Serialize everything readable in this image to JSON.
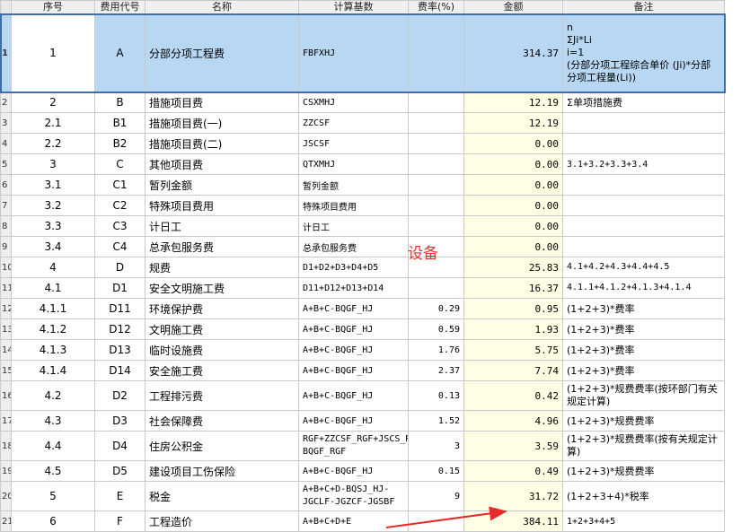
{
  "columns": {
    "seq": "序号",
    "code": "费用代号",
    "name": "名称",
    "base": "计算基数",
    "rate": "费率(%)",
    "amount": "金额",
    "note": "备注"
  },
  "annotation": "设备",
  "rows": [
    {
      "rn": "1",
      "seq": "1",
      "code": "A",
      "name": "分部分项工程费",
      "base": "FBFXHJ",
      "rate": "",
      "amount": "314.37",
      "note": "n\nΣJi*Li\ni=1\n(分部分项工程综合单价 (Ji)*分部分项工程量(Li))"
    },
    {
      "rn": "2",
      "seq": "2",
      "code": "B",
      "name": "措施项目费",
      "base": "CSXMHJ",
      "rate": "",
      "amount": "12.19",
      "note": "Σ单项措施费"
    },
    {
      "rn": "3",
      "seq": "2.1",
      "code": "B1",
      "name": "措施项目费(一)",
      "base": "ZZCSF",
      "rate": "",
      "amount": "12.19",
      "note": ""
    },
    {
      "rn": "4",
      "seq": "2.2",
      "code": "B2",
      "name": "措施项目费(二)",
      "base": "JSCSF",
      "rate": "",
      "amount": "0.00",
      "note": ""
    },
    {
      "rn": "5",
      "seq": "3",
      "code": "C",
      "name": "其他项目费",
      "base": "QTXMHJ",
      "rate": "",
      "amount": "0.00",
      "note": "3.1+3.2+3.3+3.4"
    },
    {
      "rn": "6",
      "seq": "3.1",
      "code": "C1",
      "name": "暂列金额",
      "base": "暂列金额",
      "rate": "",
      "amount": "0.00",
      "note": ""
    },
    {
      "rn": "7",
      "seq": "3.2",
      "code": "C2",
      "name": "特殊项目费用",
      "base": "特殊项目费用",
      "rate": "",
      "amount": "0.00",
      "note": ""
    },
    {
      "rn": "8",
      "seq": "3.3",
      "code": "C3",
      "name": "计日工",
      "base": "计日工",
      "rate": "",
      "amount": "0.00",
      "note": ""
    },
    {
      "rn": "9",
      "seq": "3.4",
      "code": "C4",
      "name": "总承包服务费",
      "base": "总承包服务费",
      "rate": "",
      "amount": "0.00",
      "note": ""
    },
    {
      "rn": "10",
      "seq": "4",
      "code": "D",
      "name": "规费",
      "base": "D1+D2+D3+D4+D5",
      "rate": "",
      "amount": "25.83",
      "note": "4.1+4.2+4.3+4.4+4.5"
    },
    {
      "rn": "11",
      "seq": "4.1",
      "code": "D1",
      "name": "安全文明施工费",
      "base": "D11+D12+D13+D14",
      "rate": "",
      "amount": "16.37",
      "note": "4.1.1+4.1.2+4.1.3+4.1.4"
    },
    {
      "rn": "12",
      "seq": "4.1.1",
      "code": "D11",
      "name": "环境保护费",
      "base": "A+B+C-BQGF_HJ",
      "rate": "0.29",
      "amount": "0.95",
      "note": "(1+2+3)*费率"
    },
    {
      "rn": "13",
      "seq": "4.1.2",
      "code": "D12",
      "name": "文明施工费",
      "base": "A+B+C-BQGF_HJ",
      "rate": "0.59",
      "amount": "1.93",
      "note": "(1+2+3)*费率"
    },
    {
      "rn": "14",
      "seq": "4.1.3",
      "code": "D13",
      "name": "临时设施费",
      "base": "A+B+C-BQGF_HJ",
      "rate": "1.76",
      "amount": "5.75",
      "note": "(1+2+3)*费率"
    },
    {
      "rn": "15",
      "seq": "4.1.4",
      "code": "D14",
      "name": "安全施工费",
      "base": "A+B+C-BQGF_HJ",
      "rate": "2.37",
      "amount": "7.74",
      "note": "(1+2+3)*费率"
    },
    {
      "rn": "16",
      "seq": "4.2",
      "code": "D2",
      "name": "工程排污费",
      "base": "A+B+C-BQGF_HJ",
      "rate": "0.13",
      "amount": "0.42",
      "note": "(1+2+3)*规费费率(按环部门有关规定计算)"
    },
    {
      "rn": "17",
      "seq": "4.3",
      "code": "D3",
      "name": "社会保障费",
      "base": "A+B+C-BQGF_HJ",
      "rate": "1.52",
      "amount": "4.96",
      "note": "(1+2+3)*规费费率"
    },
    {
      "rn": "18",
      "seq": "4.4",
      "code": "D4",
      "name": "住房公积金",
      "base": "RGF+ZZCSF_RGF+JSCS_RGF-BQGF_RGF",
      "rate": "3",
      "amount": "3.59",
      "note": "(1+2+3)*规费费率(按有关规定计算)"
    },
    {
      "rn": "19",
      "seq": "4.5",
      "code": "D5",
      "name": "建设项目工伤保险",
      "base": "A+B+C-BQGF_HJ",
      "rate": "0.15",
      "amount": "0.49",
      "note": "(1+2+3)*规费费率"
    },
    {
      "rn": "20",
      "seq": "5",
      "code": "E",
      "name": "税金",
      "base": "A+B+C+D-BQSJ_HJ-JGCLF-JGZCF-JGSBF",
      "rate": "9",
      "amount": "31.72",
      "note": "(1+2+3+4)*税率"
    },
    {
      "rn": "21",
      "seq": "6",
      "code": "F",
      "name": "工程造价",
      "base": "A+B+C+D+E",
      "rate": "",
      "amount": "384.11",
      "note": "1+2+3+4+5"
    }
  ]
}
